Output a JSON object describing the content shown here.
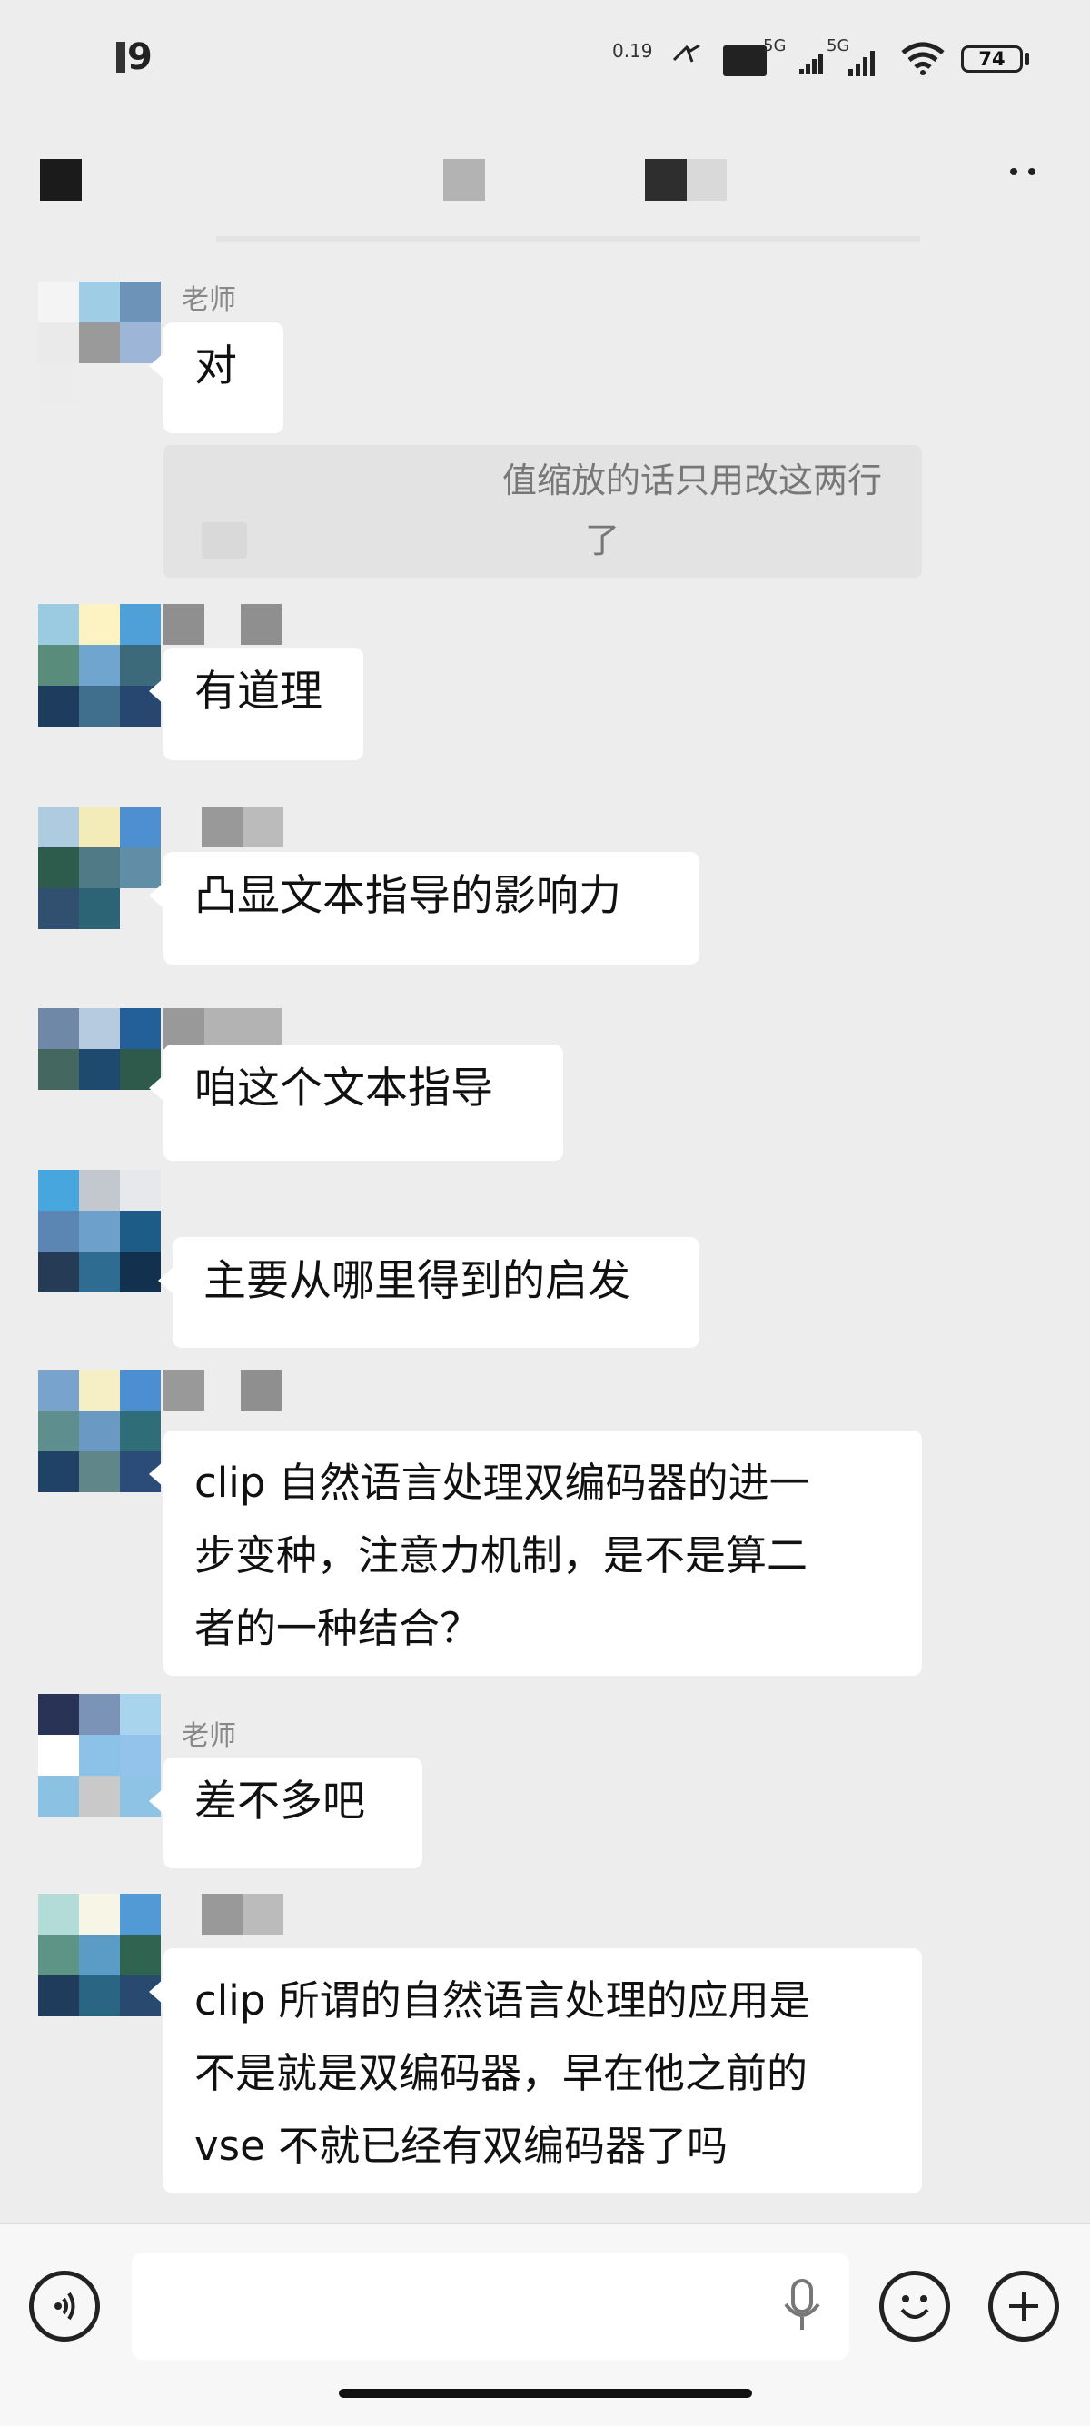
{
  "status_bar": {
    "time": "9",
    "left_mark": "‚Äö",
    "speed": "0.19",
    "net1": "5G",
    "net2": "5G",
    "battery": "74"
  },
  "messages": [
    {
      "sender": "老师",
      "text": "对"
    },
    {
      "quote": "值缩放的话只用改这两行",
      "quote2": "了"
    },
    {
      "sender": "",
      "text": "有道理"
    },
    {
      "sender": "",
      "text": "凸显文本指导的影响力"
    },
    {
      "sender": "",
      "text": "咱这个文本指导"
    },
    {
      "sender": "",
      "text": "主要从哪里得到的启发"
    },
    {
      "sender": "",
      "text": "clip 自然语言处理双编码器的进一\n步变种，注意力机制，是不是算二\n者的一种结合？"
    },
    {
      "sender": "老师",
      "text": "差不多吧"
    },
    {
      "sender": "",
      "text": "clip 所谓的自然语言处理的应用是\n不是就是双编码器，早在他之前的\nvse 不就已经有双编码器了吗"
    }
  ],
  "input": {
    "placeholder": ""
  },
  "icons": [
    "voice-icon",
    "microphone-icon",
    "emoji-icon",
    "plus-icon",
    "more-icon"
  ]
}
